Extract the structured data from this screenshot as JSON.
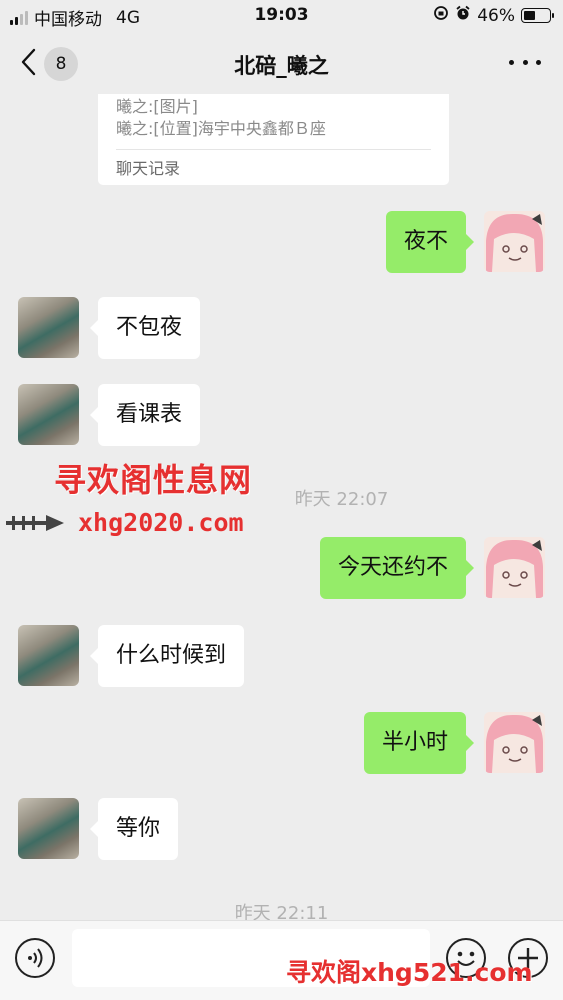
{
  "status_bar": {
    "carrier": "中国移动",
    "network": "4G",
    "time": "19:03",
    "battery_percent": "46%",
    "battery_level": 0.46
  },
  "nav": {
    "unread_count": "8",
    "title": "北碚_曦之"
  },
  "quoted_card": {
    "lines": [
      "曦之:[图片]",
      "曦之:[位置]海宇中央鑫都Ｂ座"
    ],
    "footer": "聊天记录"
  },
  "messages": [
    {
      "sender": "me",
      "text": "夜不"
    },
    {
      "sender": "them",
      "text": "不包夜"
    },
    {
      "sender": "them",
      "text": "看课表"
    },
    {
      "sender": "me",
      "text": "今天还约不"
    },
    {
      "sender": "them",
      "text": "什么时候到"
    },
    {
      "sender": "me",
      "text": "半小时"
    },
    {
      "sender": "them",
      "text": "等你"
    }
  ],
  "timestamps": [
    "昨天 22:07",
    "昨天 22:11"
  ],
  "watermarks": {
    "mid_line1": "寻欢阁性息网",
    "mid_line2": "xhg2020.com",
    "bottom": "寻欢阁xhg521.com"
  },
  "colors": {
    "my_bubble": "#95ec69",
    "their_bubble": "#ffffff",
    "background": "#ededed",
    "watermark": "#e63030"
  }
}
